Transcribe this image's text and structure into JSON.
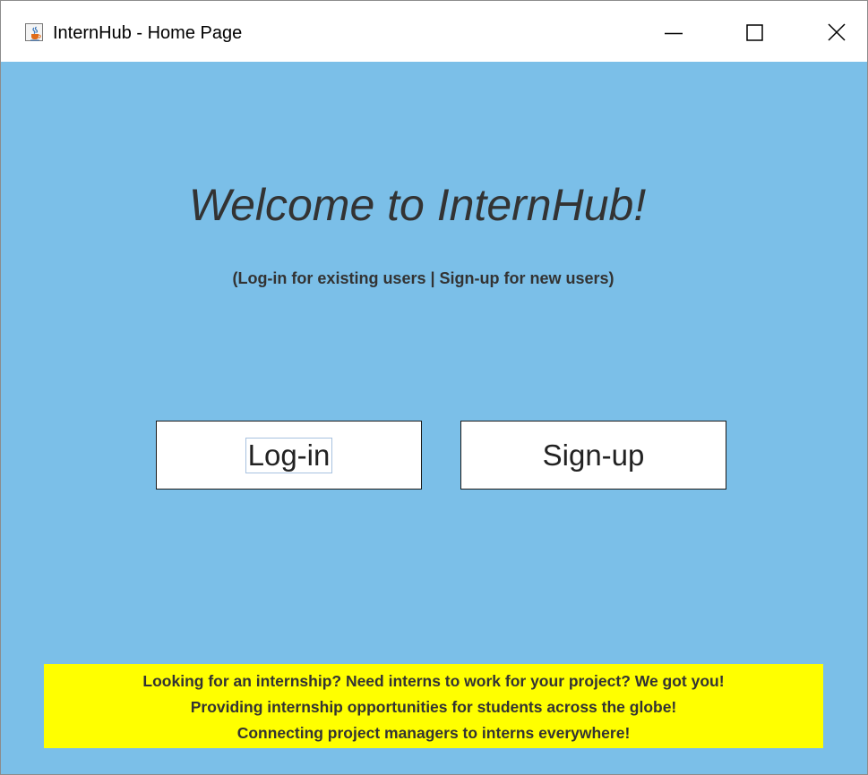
{
  "window": {
    "title": "InternHub - Home Page",
    "icon": "java-cup-icon",
    "controls": {
      "minimize": "minimize-icon",
      "maximize": "maximize-icon",
      "close": "close-icon"
    }
  },
  "home": {
    "welcome": "Welcome to InternHub!",
    "subtitle": "(Log-in for existing users | Sign-up for new users)",
    "login_label": "Log-in",
    "signup_label": "Sign-up"
  },
  "banner": {
    "lines": [
      "Looking for an internship? Need interns to work for your project? We got you!",
      "Providing internship opportunities for students across the globe!",
      "Connecting project managers to interns everywhere!"
    ]
  },
  "colors": {
    "background": "#7bbfe8",
    "banner": "#ffff00",
    "text": "#333333"
  }
}
